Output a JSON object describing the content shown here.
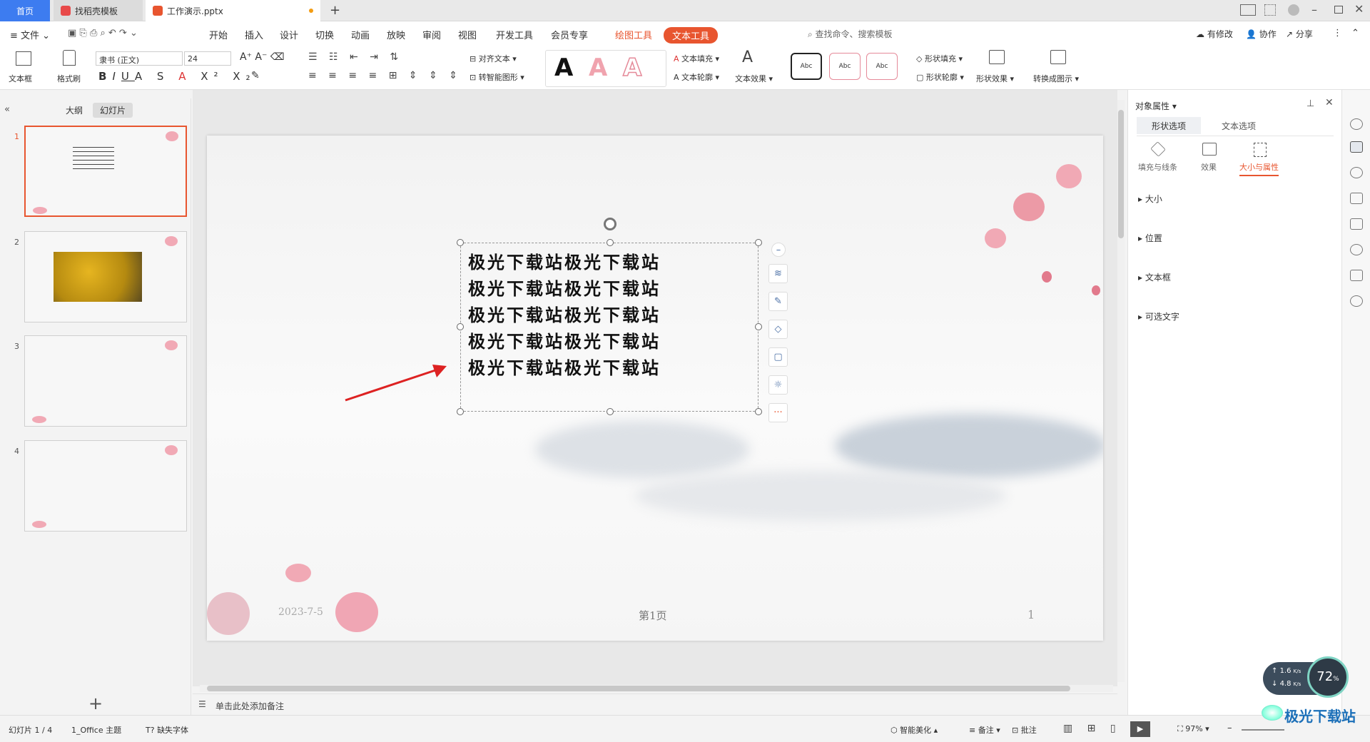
{
  "tabs": {
    "home": "首页",
    "template": "找稻壳模板",
    "file": "工作演示.pptx"
  },
  "menu": {
    "file": "文件",
    "items": [
      "开始",
      "插入",
      "设计",
      "切换",
      "动画",
      "放映",
      "审阅",
      "视图",
      "开发工具",
      "会员专享"
    ],
    "drawing_tools": "绘图工具",
    "text_tools": "文本工具",
    "search": "查找命令、搜索模板",
    "right": [
      "有修改",
      "协作",
      "分享"
    ]
  },
  "ribbon": {
    "textbox": "文本框",
    "format_painter": "格式刷",
    "font": "隶书 (正文)",
    "size": "24",
    "align_text": "对齐文本",
    "smart_shape": "转智能图形",
    "text_fill": "文本填充",
    "text_outline": "文本轮廓",
    "text_effect": "文本效果",
    "style_sample": "Abc",
    "shape_fill": "形状填充",
    "shape_outline": "形状轮廓",
    "shape_effect": "形状效果",
    "convert": "转换成图示",
    "big_a": "A"
  },
  "left": {
    "outline_tab": "大纲",
    "slides_tab": "幻灯片",
    "numbers": [
      "1",
      "2",
      "3",
      "4"
    ]
  },
  "slide": {
    "lines": [
      "极光下载站极光下载站",
      "极光下载站极光下载站",
      "极光下载站极光下载站",
      "极光下载站极光下载站",
      "极光下载站极光下载站"
    ],
    "date": "2023-7-5",
    "page_label": "第1页",
    "page_number": "1"
  },
  "right": {
    "title": "对象属性",
    "tab_shape": "形状选项",
    "tab_text": "文本选项",
    "sub_fill": "填充与线条",
    "sub_effect": "效果",
    "sub_size": "大小与属性",
    "sections": [
      "大小",
      "位置",
      "文本框",
      "可选文字"
    ]
  },
  "notes": {
    "placeholder": "单击此处添加备注"
  },
  "status": {
    "slide_count": "幻灯片 1 / 4",
    "theme": "1_Office 主题",
    "missing_font": "缺失字体",
    "beautify": "智能美化",
    "notes": "备注",
    "comment": "批注",
    "zoom": "97%"
  },
  "speed": {
    "up": "1.6",
    "down": "4.8",
    "unit": "K/s",
    "percent": "72"
  },
  "watermark": "极光下载站",
  "colors": {
    "accent": "#e8552f",
    "blue": "#3d7cf0"
  }
}
